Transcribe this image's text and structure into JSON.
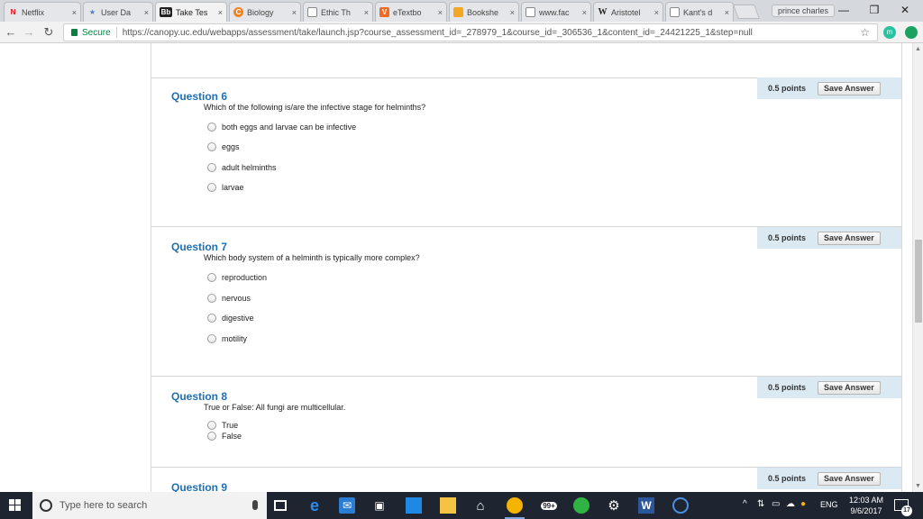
{
  "browser": {
    "tabs": [
      {
        "label": "Netflix",
        "icon": "netflix-icon",
        "icon_glyph": "N",
        "color": "#e50914"
      },
      {
        "label": "User Da",
        "icon": "star-icon",
        "icon_glyph": "★",
        "color": "#4a7fcf"
      },
      {
        "label": "Take Tes",
        "icon": "blackboard-icon",
        "icon_glyph": "Bb",
        "color": "#222222"
      },
      {
        "label": "Biology",
        "icon": "chegg-icon",
        "icon_glyph": "C",
        "color": "#f5821f"
      },
      {
        "label": "Ethic Th",
        "icon": "page-icon",
        "icon_glyph": "",
        "color": "#ffffff"
      },
      {
        "label": "eTextbo",
        "icon": "vitalsource-icon",
        "icon_glyph": "V",
        "color": "#f26a21"
      },
      {
        "label": "Bookshe",
        "icon": "bookshelf-icon",
        "icon_glyph": "",
        "color": "#f5a623"
      },
      {
        "label": "www.fac",
        "icon": "page-icon",
        "icon_glyph": "",
        "color": "#ffffff"
      },
      {
        "label": "Aristotel",
        "icon": "wikipedia-icon",
        "icon_glyph": "W",
        "color": "#ffffff"
      },
      {
        "label": "Kant's d",
        "icon": "page-icon",
        "icon_glyph": "",
        "color": "#ffffff"
      }
    ],
    "tab_close": "×",
    "profile_name": "prince charles",
    "window_controls": {
      "minimize": "—",
      "restore": "❐",
      "close": "✕"
    },
    "nav": {
      "back": "←",
      "forward": "→",
      "reload": "↻"
    },
    "secure_label": "Secure",
    "url": "https://canopy.uc.edu/webapps/assessment/take/launch.jsp?course_assessment_id=_278979_1&course_id=_306536_1&content_id=_24421225_1&step=null",
    "bookmark_star": "☆",
    "extension_label": "m"
  },
  "questions": [
    {
      "title": "Question 6",
      "points": "0.5 points",
      "save_label": "Save Answer",
      "text": "Which of the following is/are the infective stage for helminths?",
      "options": [
        "both eggs and larvae can be infective",
        "eggs",
        "adult helminths",
        "larvae"
      ]
    },
    {
      "title": "Question 7",
      "points": "0.5 points",
      "save_label": "Save Answer",
      "text": "Which body system of a helminth is typically more complex?",
      "options": [
        "reproduction",
        "nervous",
        "digestive",
        "motility"
      ]
    },
    {
      "title": "Question 8",
      "points": "0.5 points",
      "save_label": "Save Answer",
      "text": "True or False:  All fungi are multicellular.",
      "options": [
        "True",
        "False"
      ]
    },
    {
      "title": "Question 9",
      "points": "0.5 points",
      "save_label": "Save Answer"
    }
  ],
  "taskbar": {
    "search_placeholder": "Type here to search",
    "tray_language": "ENG",
    "time": "12:03 AM",
    "date": "9/6/2017",
    "mail_badge": "99+",
    "notification_count": "17"
  },
  "colors": {
    "question_title": "#1f6fb2",
    "points_bar": "#dbe9f2",
    "secure_green": "#0b8043",
    "taskbar": "#1f2530"
  }
}
